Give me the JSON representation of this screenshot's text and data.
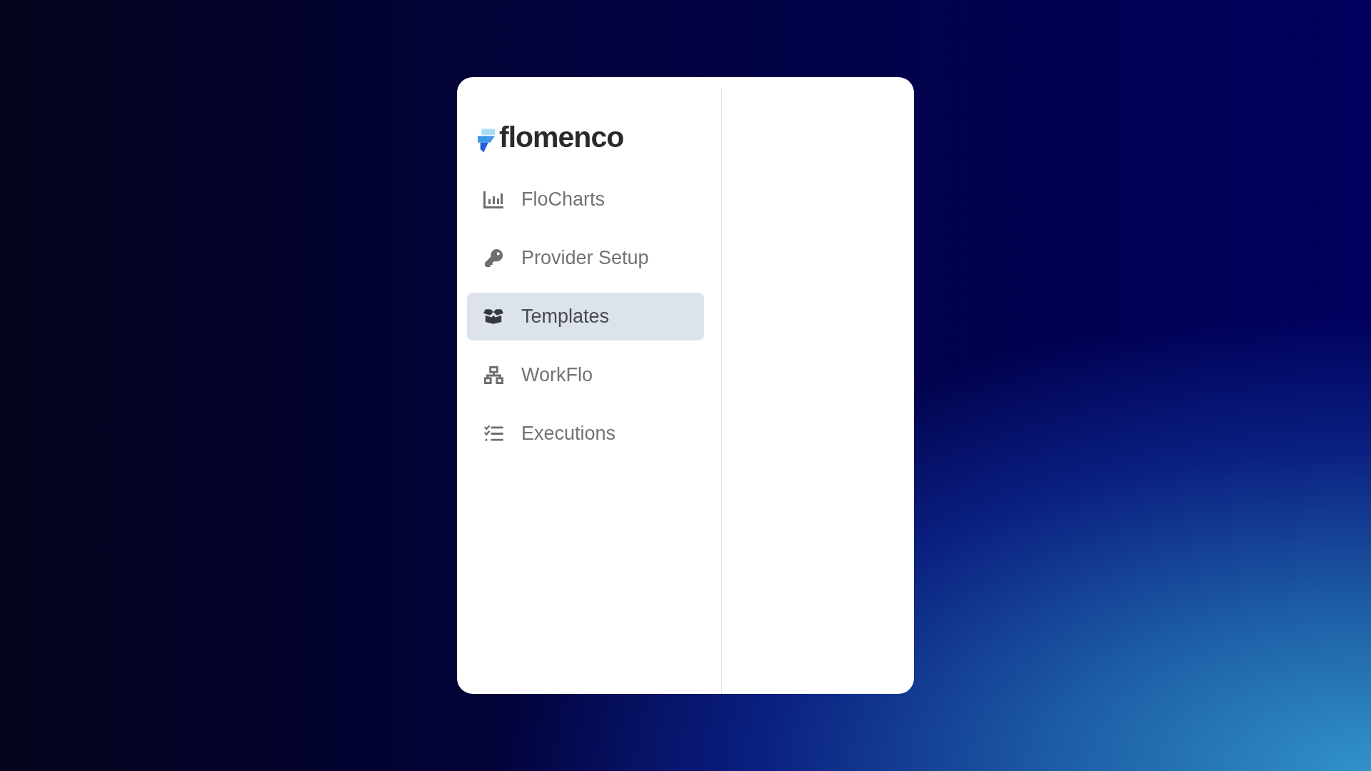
{
  "logo": {
    "name": "flomenco"
  },
  "nav": [
    {
      "label": "FloCharts",
      "selected": false
    },
    {
      "label": "Provider Setup",
      "selected": false
    },
    {
      "label": "Templates",
      "selected": true
    },
    {
      "label": "WorkFlo",
      "selected": false
    },
    {
      "label": "Executions",
      "selected": false
    }
  ]
}
